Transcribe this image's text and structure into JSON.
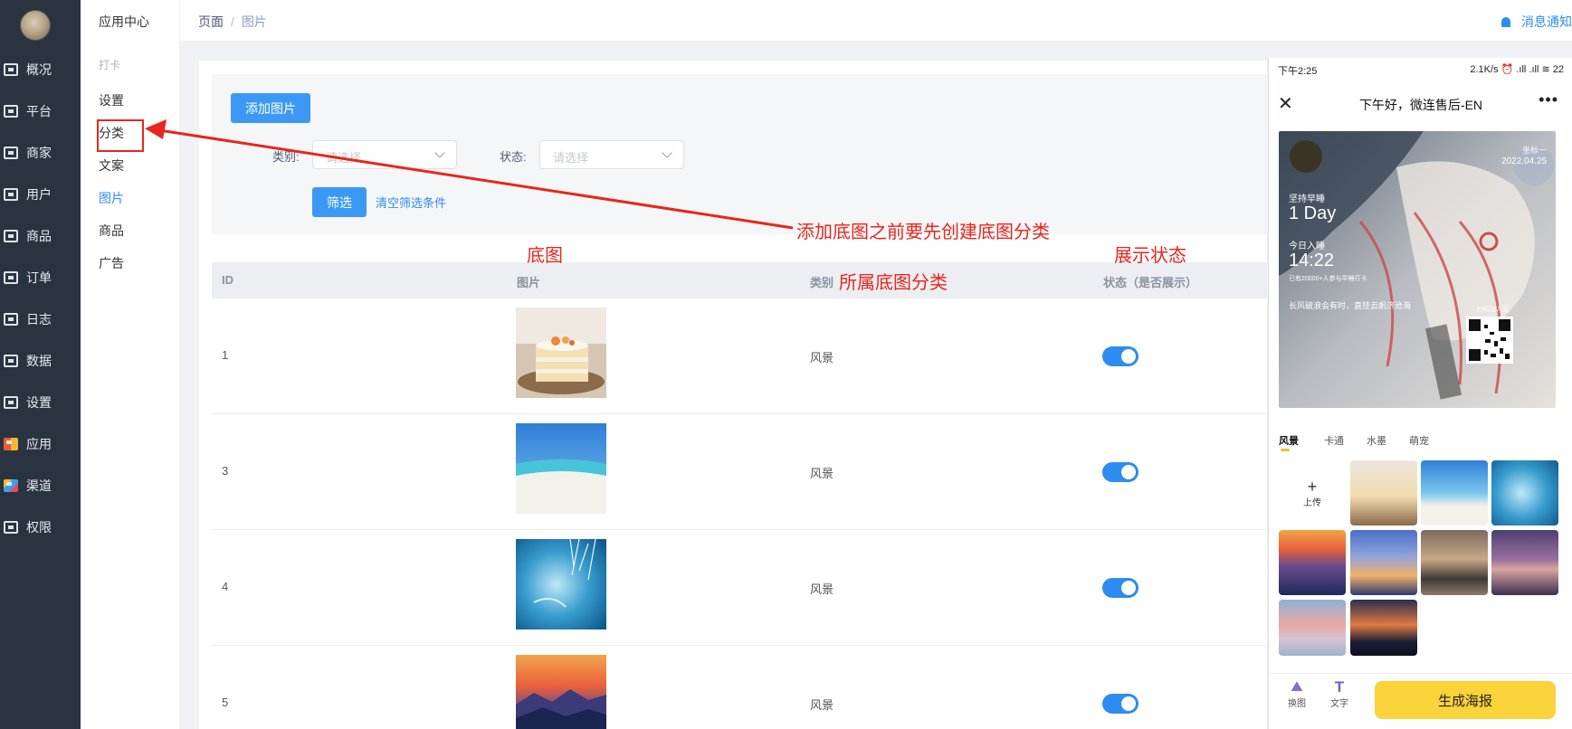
{
  "sidebar": {
    "items": [
      {
        "label": "概况",
        "icon": "dashboard-icon"
      },
      {
        "label": "平台",
        "icon": "monitor-icon"
      },
      {
        "label": "商家",
        "icon": "store-icon"
      },
      {
        "label": "用户",
        "icon": "user-icon"
      },
      {
        "label": "商品",
        "icon": "bag-icon"
      },
      {
        "label": "订单",
        "icon": "order-icon"
      },
      {
        "label": "日志",
        "icon": "log-icon"
      },
      {
        "label": "数据",
        "icon": "bar-chart-icon"
      },
      {
        "label": "设置",
        "icon": "gear-icon"
      },
      {
        "label": "应用",
        "icon": "apps-icon"
      },
      {
        "label": "渠道",
        "icon": "cube-icon"
      },
      {
        "label": "权限",
        "icon": "lock-icon"
      }
    ]
  },
  "submenu": {
    "title": "应用中心",
    "group": "打卡",
    "items": [
      {
        "label": "设置",
        "active": false
      },
      {
        "label": "分类",
        "active": false
      },
      {
        "label": "文案",
        "active": false
      },
      {
        "label": "图片",
        "active": true
      },
      {
        "label": "商品",
        "active": false
      },
      {
        "label": "广告",
        "active": false
      }
    ]
  },
  "header": {
    "breadcrumb": [
      "页面",
      "图片"
    ],
    "notice": "消息通知"
  },
  "toolbar": {
    "add_label": "添加图片"
  },
  "filters": {
    "category_label": "类别:",
    "category_placeholder": "请选择",
    "status_label": "状态:",
    "status_placeholder": "请选择",
    "filter_button": "筛选",
    "clear_link": "清空筛选条件"
  },
  "table": {
    "columns": [
      "ID",
      "图片",
      "类别",
      "状态（是否展示）"
    ],
    "rows": [
      {
        "id": "1",
        "category": "风景",
        "shown": true,
        "image": "cake"
      },
      {
        "id": "3",
        "category": "风景",
        "shown": true,
        "image": "beach"
      },
      {
        "id": "4",
        "category": "风景",
        "shown": true,
        "image": "frost"
      },
      {
        "id": "5",
        "category": "风景",
        "shown": true,
        "image": "sunset-mountains"
      }
    ]
  },
  "annotations": {
    "arrow_note": "添加底图之前要先创建底图分类",
    "image_note": "底图",
    "category_note": "所属底图分类",
    "status_note": "展示状态",
    "color": "#e8251f"
  },
  "phone": {
    "time": "下午2:25",
    "status_right": "2.1K/s ⏰ .ıll .ıll ≋ 22",
    "title": "下午好，微连售后-EN",
    "poster": {
      "date": "2022.04.25",
      "name_tag": "坐标一",
      "streak_label": "坚持早睡",
      "streak_value": "1 Day",
      "checkin_label": "今日入睡",
      "checkin_time": "14:22",
      "checkin_sub": "已有20000+人参与早睡打卡",
      "quote": "长风破浪会有时，直挂云帆济沧海",
      "qr_caption": "扫码加入我"
    },
    "tabs": [
      "风景",
      "卡通",
      "水墨",
      "萌宠"
    ],
    "upload_label": "上传",
    "bottom": {
      "swap": "换图",
      "text": "文字",
      "generate": "生成海报"
    }
  }
}
